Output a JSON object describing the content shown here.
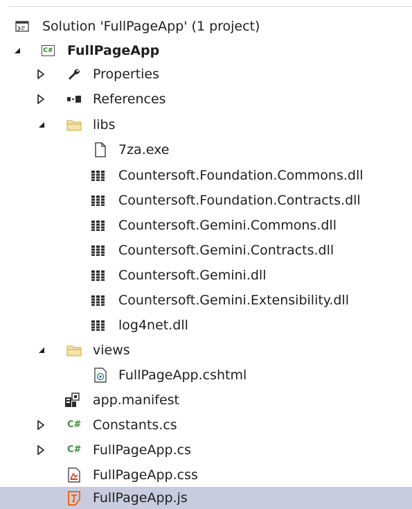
{
  "colors": {
    "selection": "#c9ccdf",
    "text": "#1e1e1e",
    "csharp": "#3a8f3a",
    "folder": "#dcc276",
    "js": "#e66a1f"
  },
  "tree": {
    "solution": {
      "label": "Solution 'FullPageApp' (1 project)",
      "icon": "solution-icon"
    },
    "project": {
      "label": "FullPageApp",
      "badge": "C#",
      "icon": "csharp-project-icon"
    },
    "properties": {
      "label": "Properties",
      "icon": "wrench-icon"
    },
    "references": {
      "label": "References",
      "icon": "references-icon"
    },
    "libs": {
      "label": "libs",
      "icon": "folder-icon",
      "items": [
        {
          "label": "7za.exe",
          "icon": "file-icon"
        },
        {
          "label": "Countersoft.Foundation.Commons.dll",
          "icon": "dll-icon"
        },
        {
          "label": "Countersoft.Foundation.Contracts.dll",
          "icon": "dll-icon"
        },
        {
          "label": "Countersoft.Gemini.Commons.dll",
          "icon": "dll-icon"
        },
        {
          "label": "Countersoft.Gemini.Contracts.dll",
          "icon": "dll-icon"
        },
        {
          "label": "Countersoft.Gemini.dll",
          "icon": "dll-icon"
        },
        {
          "label": "Countersoft.Gemini.Extensibility.dll",
          "icon": "dll-icon"
        },
        {
          "label": "log4net.dll",
          "icon": "dll-icon"
        }
      ]
    },
    "views": {
      "label": "views",
      "icon": "folder-icon",
      "items": [
        {
          "label": "FullPageApp.cshtml",
          "icon": "cshtml-icon"
        }
      ]
    },
    "manifest": {
      "label": "app.manifest",
      "icon": "manifest-icon"
    },
    "constants": {
      "label": "Constants.cs",
      "badge": "C#",
      "icon": "csharp-file-icon"
    },
    "fullpageapp_cs": {
      "label": "FullPageApp.cs",
      "badge": "C#",
      "icon": "csharp-file-icon"
    },
    "fullpageapp_css": {
      "label": "FullPageApp.css",
      "icon": "css-file-icon"
    },
    "fullpageapp_js": {
      "label": "FullPageApp.js",
      "icon": "js-file-icon",
      "selected": true
    }
  }
}
